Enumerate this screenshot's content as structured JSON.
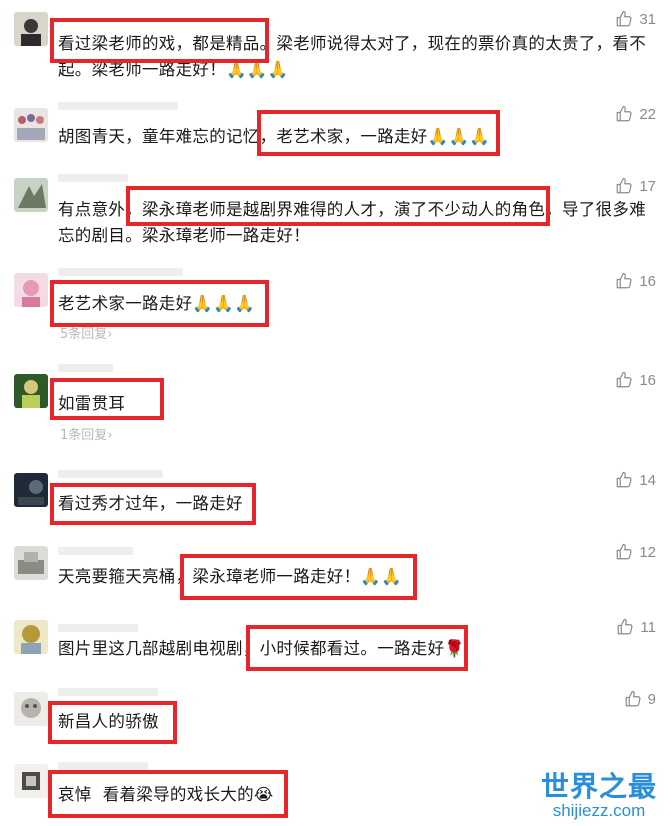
{
  "comments": [
    {
      "text": "看过梁老师的戏，都是精品。梁老师说得太对了，现在的票价真的太贵了，看不起。梁老师一路走好！🙏🙏🙏",
      "likes": "31",
      "replies": ""
    },
    {
      "text": "胡图青天，童年难忘的记忆，老艺术家，一路走好🙏🙏🙏",
      "likes": "22",
      "replies": ""
    },
    {
      "text": "有点意外，梁永璋老师是越剧界难得的人才，演了不少动人的角色，导了很多难忘的剧目。梁永璋老师一路走好！",
      "likes": "17",
      "replies": ""
    },
    {
      "text": "老艺术家一路走好🙏🙏🙏",
      "likes": "16",
      "replies": "5条回复›"
    },
    {
      "text": "如雷贯耳",
      "likes": "16",
      "replies": "1条回复›"
    },
    {
      "text": "看过秀才过年，一路走好",
      "likes": "14",
      "replies": ""
    },
    {
      "text": "天亮要箍天亮桶，梁永璋老师一路走好！🙏🙏",
      "likes": "12",
      "replies": ""
    },
    {
      "text": "图片里这几部越剧电视剧，小时候都看过。一路走好🌹",
      "likes": "11",
      "replies": ""
    },
    {
      "text": "新昌人的骄傲",
      "likes": "9",
      "replies": ""
    },
    {
      "text": "哀悼  看着梁导的戏长大的😭",
      "likes": "",
      "replies": ""
    }
  ],
  "icons": {
    "like": "thumbs-up-icon"
  },
  "colors": {
    "highlight": "#e6262b",
    "muted": "#8a8a8a",
    "watermark": "#2a8fd8"
  },
  "watermark": {
    "main": "世界之最",
    "sub": "shijiezz.com"
  }
}
